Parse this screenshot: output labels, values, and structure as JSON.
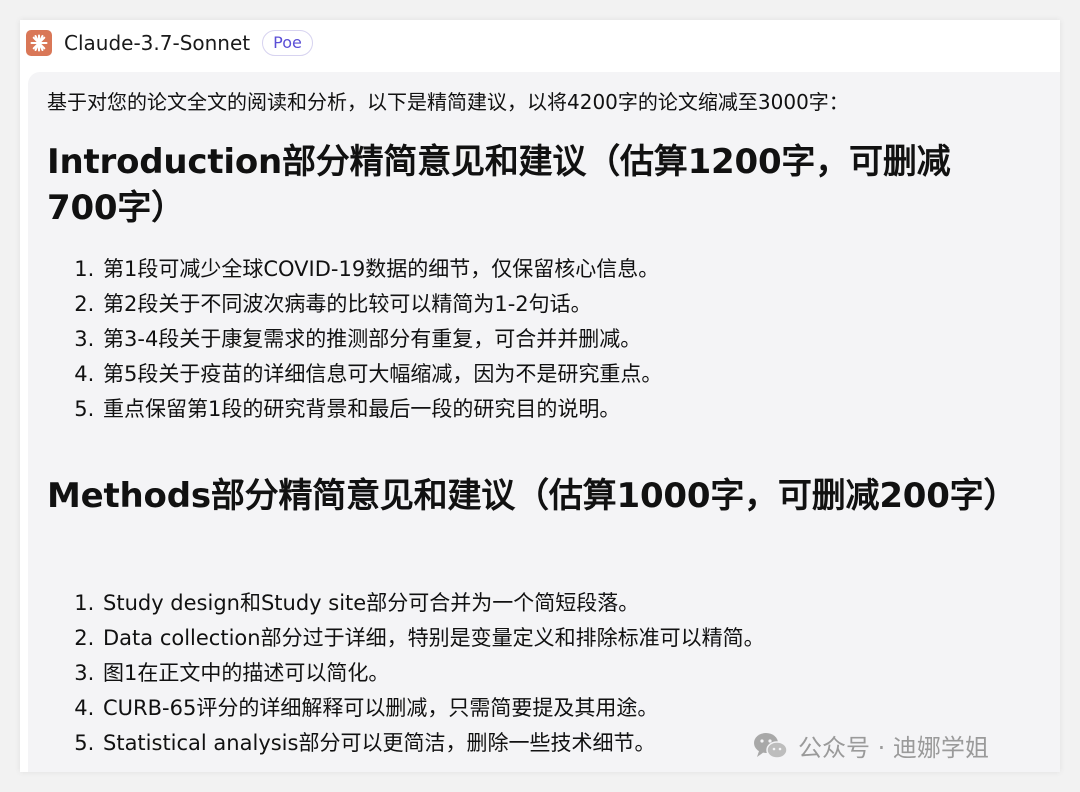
{
  "header": {
    "bot_name": "Claude-3.7-Sonnet",
    "badge": "Poe",
    "avatar_icon": "claude-starburst-icon",
    "avatar_color": "#d97757"
  },
  "message": {
    "intro": "基于对您的论文全文的阅读和分析，以下是精简建议，以将4200字的论文缩减至3000字：",
    "sections": [
      {
        "heading": "Introduction部分精简意见和建议（估算1200字，可删减700字）",
        "items": [
          "第1段可减少全球COVID-19数据的细节，仅保留核心信息。",
          "第2段关于不同波次病毒的比较可以精简为1-2句话。",
          "第3-4段关于康复需求的推测部分有重复，可合并并删减。",
          "第5段关于疫苗的详细信息可大幅缩减，因为不是研究重点。",
          "重点保留第1段的研究背景和最后一段的研究目的说明。"
        ]
      },
      {
        "heading": "Methods部分精简意见和建议（估算1000字，可删减200字）",
        "items": [
          "Study design和Study site部分可合并为一个简短段落。",
          "Data collection部分过于详细，特别是变量定义和排除标准可以精简。",
          "图1在正文中的描述可以简化。",
          "CURB-65评分的详细解释可以删减，只需简要提及其用途。",
          "Statistical analysis部分可以更简洁，删除一些技术细节。"
        ]
      }
    ]
  },
  "watermark": {
    "text": "公众号 · 迪娜学姐",
    "icon": "wechat-icon"
  }
}
